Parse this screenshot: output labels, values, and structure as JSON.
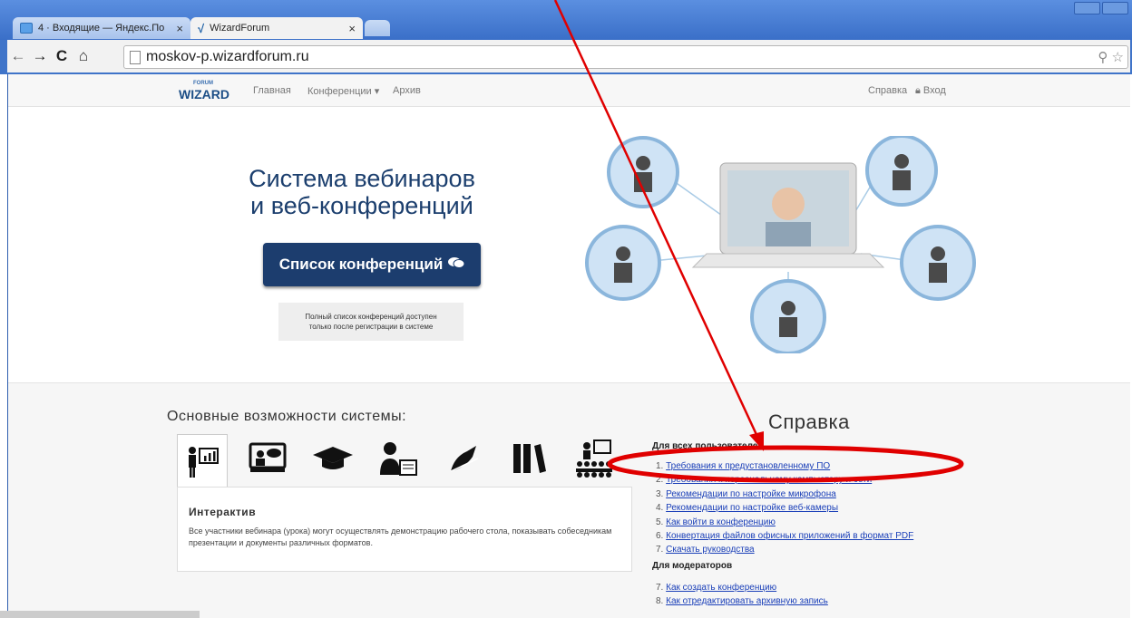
{
  "browser": {
    "tabs": [
      {
        "title": "4 · Входящие — Яндекс.По",
        "close": "×"
      },
      {
        "title": "WizardForum",
        "close": "×"
      }
    ],
    "url": "moskov-p.wizardforum.ru",
    "nav_glyphs": {
      "back": "←",
      "forward": "→",
      "reload": "C",
      "home": "⌂"
    },
    "url_icons": "⚲ ☆"
  },
  "site": {
    "logo_main": "WIZARD",
    "logo_small": "FORUM",
    "nav": {
      "home": "Главная",
      "conferences": "Конференции ▾",
      "archive": "Архив",
      "help": "Справка",
      "login": "Вход"
    },
    "hero": {
      "title_line1": "Система вебинаров",
      "title_line2": "и веб-конференций",
      "button": "Список конференций",
      "note_line1": "Полный список конференций доступен",
      "note_line2": "только после регистрации в системе"
    },
    "features": {
      "title": "Основные возможности системы:",
      "icons": [
        "presenter-icon",
        "screen-chat-icon",
        "graduation-cap-icon",
        "user-document-icon",
        "pen-sign-icon",
        "books-icon",
        "audience-icon"
      ],
      "selected_heading": "Интерактив",
      "selected_desc": "Все участники вебинара (урока) могут осуществлять демонстрацию рабочего стола, показывать собеседникам презентации и документы различных форматов."
    },
    "help": {
      "title": "Справка",
      "section_all": "Для всех пользователей",
      "section_mod": "Для модераторов",
      "items_all": [
        "Требования к предустановленному ПО",
        "Требования к персональному компьютеру и сети",
        "Рекомендации по настройке микрофона",
        "Рекомендации по настройке веб-камеры",
        "Как войти в конференцию",
        "Конвертация файлов офисных приложений в формат PDF",
        "Скачать руководства"
      ],
      "nums_all": [
        "1.",
        "2.",
        "3.",
        "4.",
        "5.",
        "6.",
        "7."
      ],
      "items_mod": [
        "Как создать конференцию",
        "Как отредактировать архивную запись"
      ],
      "nums_mod": [
        "7.",
        "8."
      ]
    }
  },
  "colors": {
    "annotation": "#e00000",
    "brand": "#1c3d6e",
    "link": "#1a3fb8"
  }
}
